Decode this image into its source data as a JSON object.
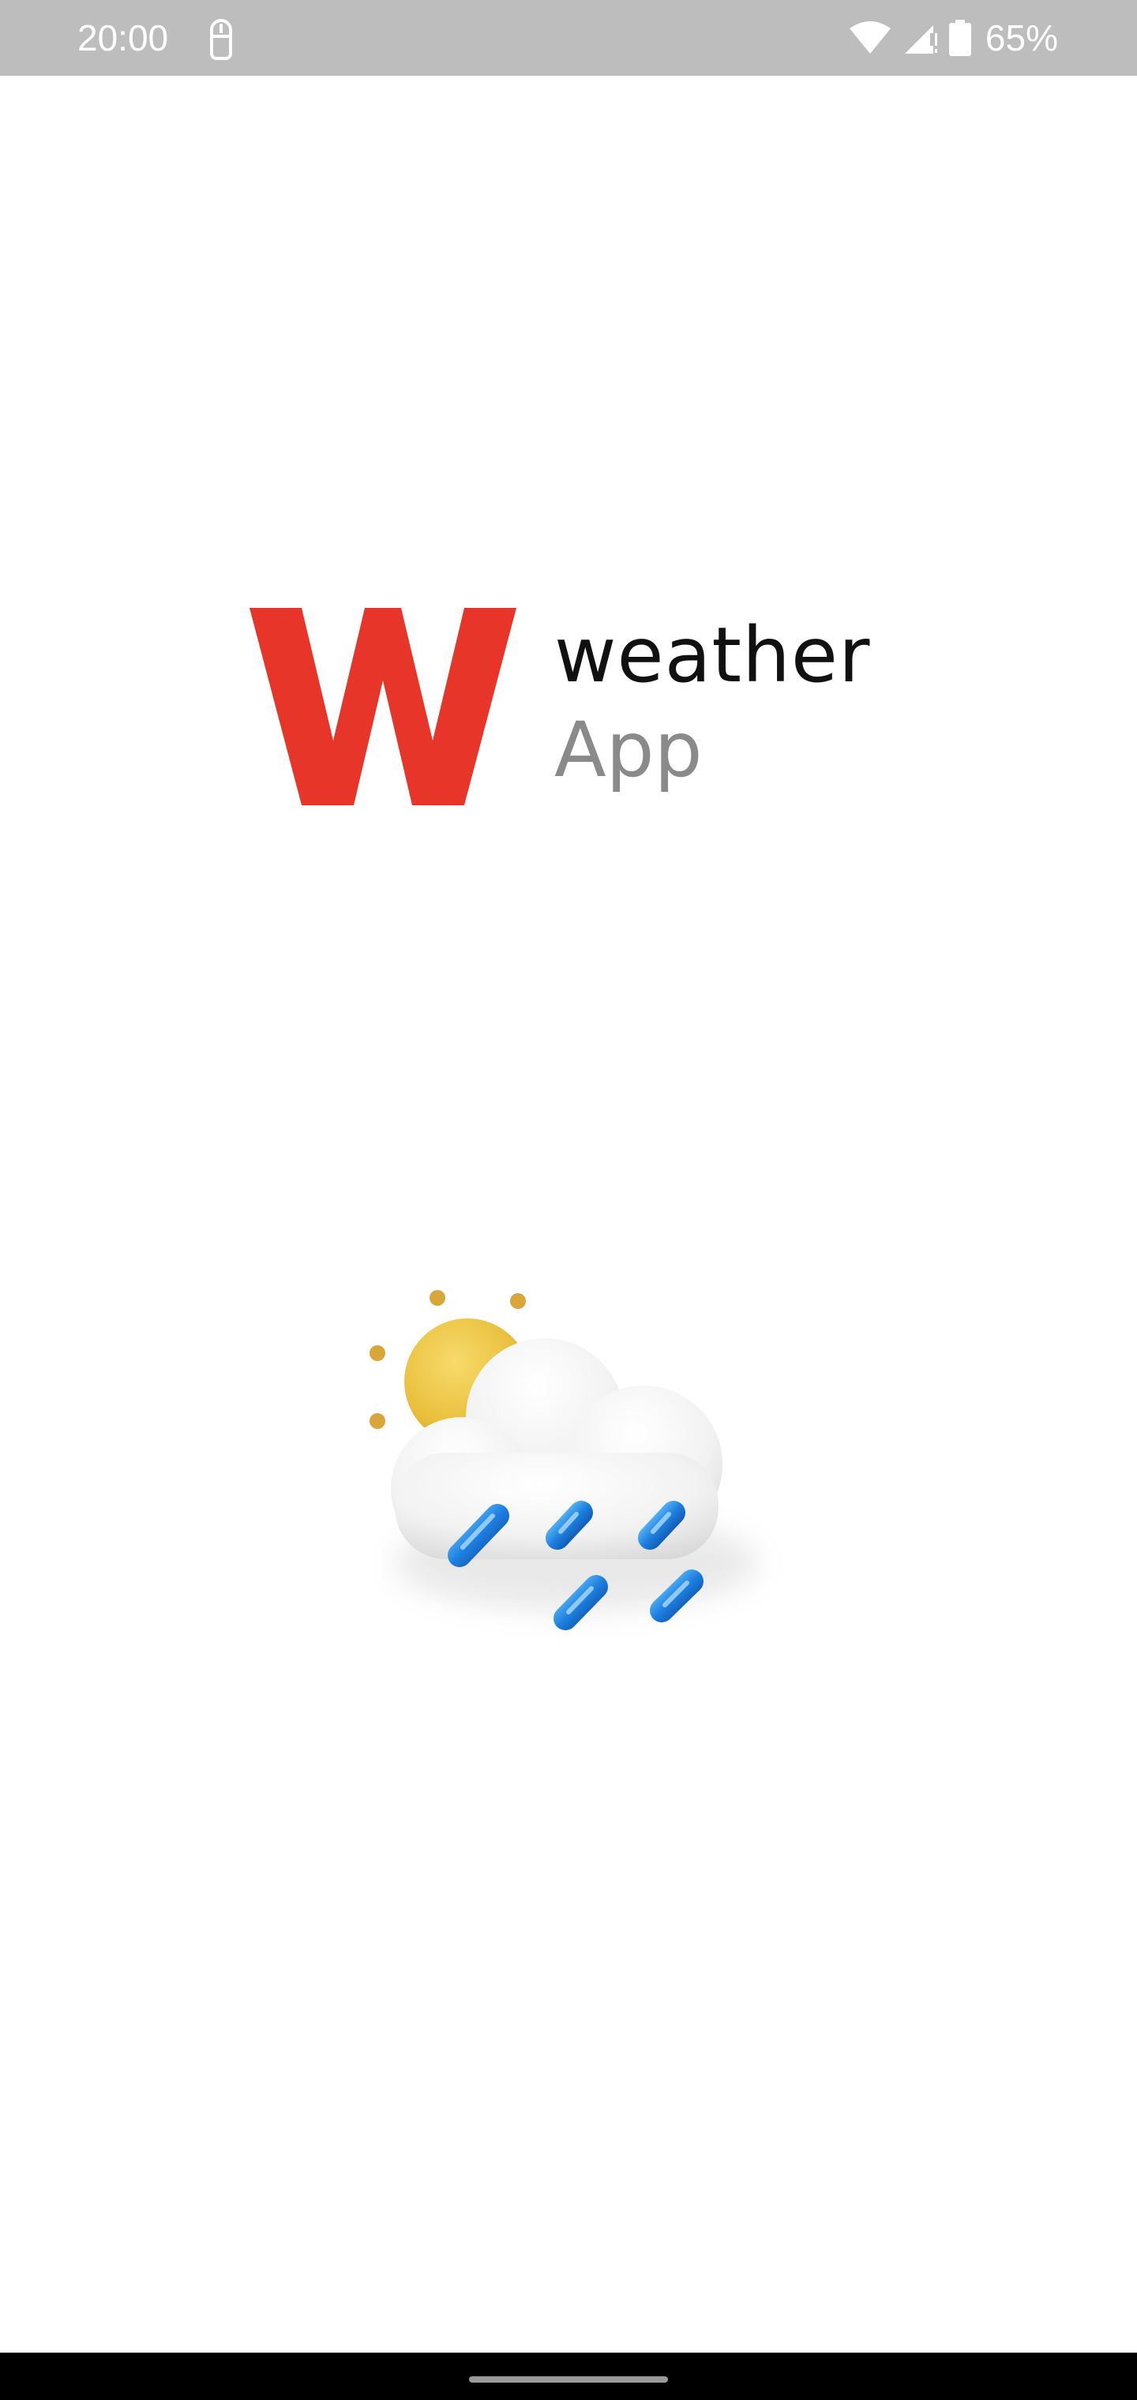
{
  "status_bar": {
    "time": "20:00",
    "battery_percent": "65%",
    "icons": [
      "lock-download-icon",
      "wifi-icon",
      "signal-icon",
      "battery-icon"
    ],
    "background": "#bdbdbd"
  },
  "splash": {
    "logo_letter": "W",
    "logo_line1": "weather",
    "logo_line2": "App",
    "brand_color": "#e8352a",
    "illustration_icon": "sun-cloud-rain-icon"
  },
  "nav_bar": {
    "handle": "home-gesture-handle"
  }
}
